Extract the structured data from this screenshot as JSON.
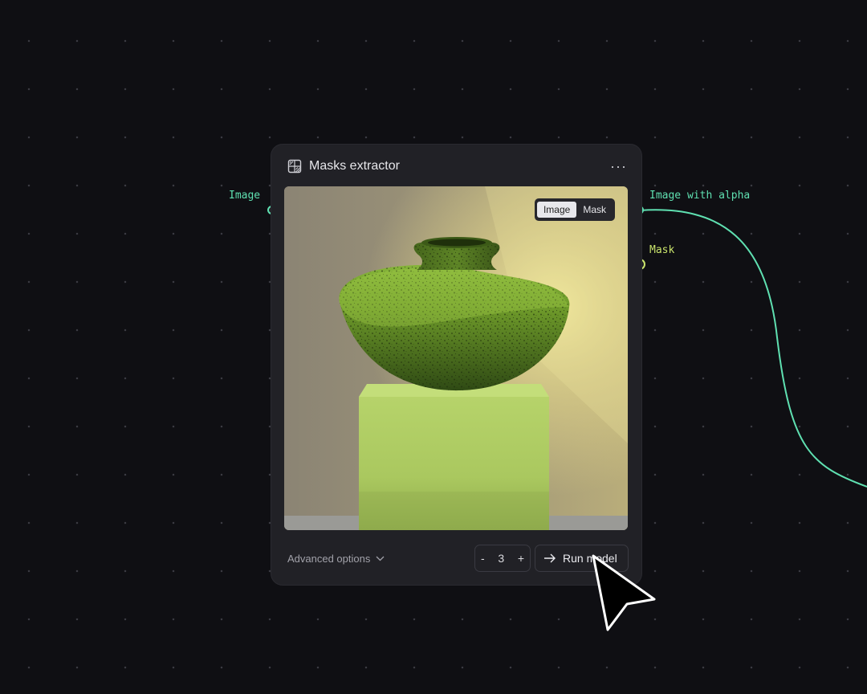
{
  "node": {
    "title": "Masks extractor",
    "icon": "mask-grid-icon",
    "menu_label": "···"
  },
  "inputs": [
    {
      "label": "Image",
      "color": "#5fe0b1"
    }
  ],
  "outputs": [
    {
      "label": "Image with alpha",
      "color": "#5fe0b1",
      "connected": true
    },
    {
      "label": "Mask",
      "color": "#c9e36c",
      "connected": false
    }
  ],
  "preview": {
    "toggle": {
      "options": [
        "Image",
        "Mask"
      ],
      "selected": "Image"
    }
  },
  "footer": {
    "advanced_label": "Advanced options",
    "stepper": {
      "minus": "-",
      "value": "3",
      "plus": "+"
    },
    "run_label": "Run model"
  },
  "colors": {
    "background": "#0f0f13",
    "node_bg": "#212126",
    "wire": "#5fe0b1",
    "accent_green": "#5fe0b1",
    "accent_yellow": "#c9e36c"
  }
}
